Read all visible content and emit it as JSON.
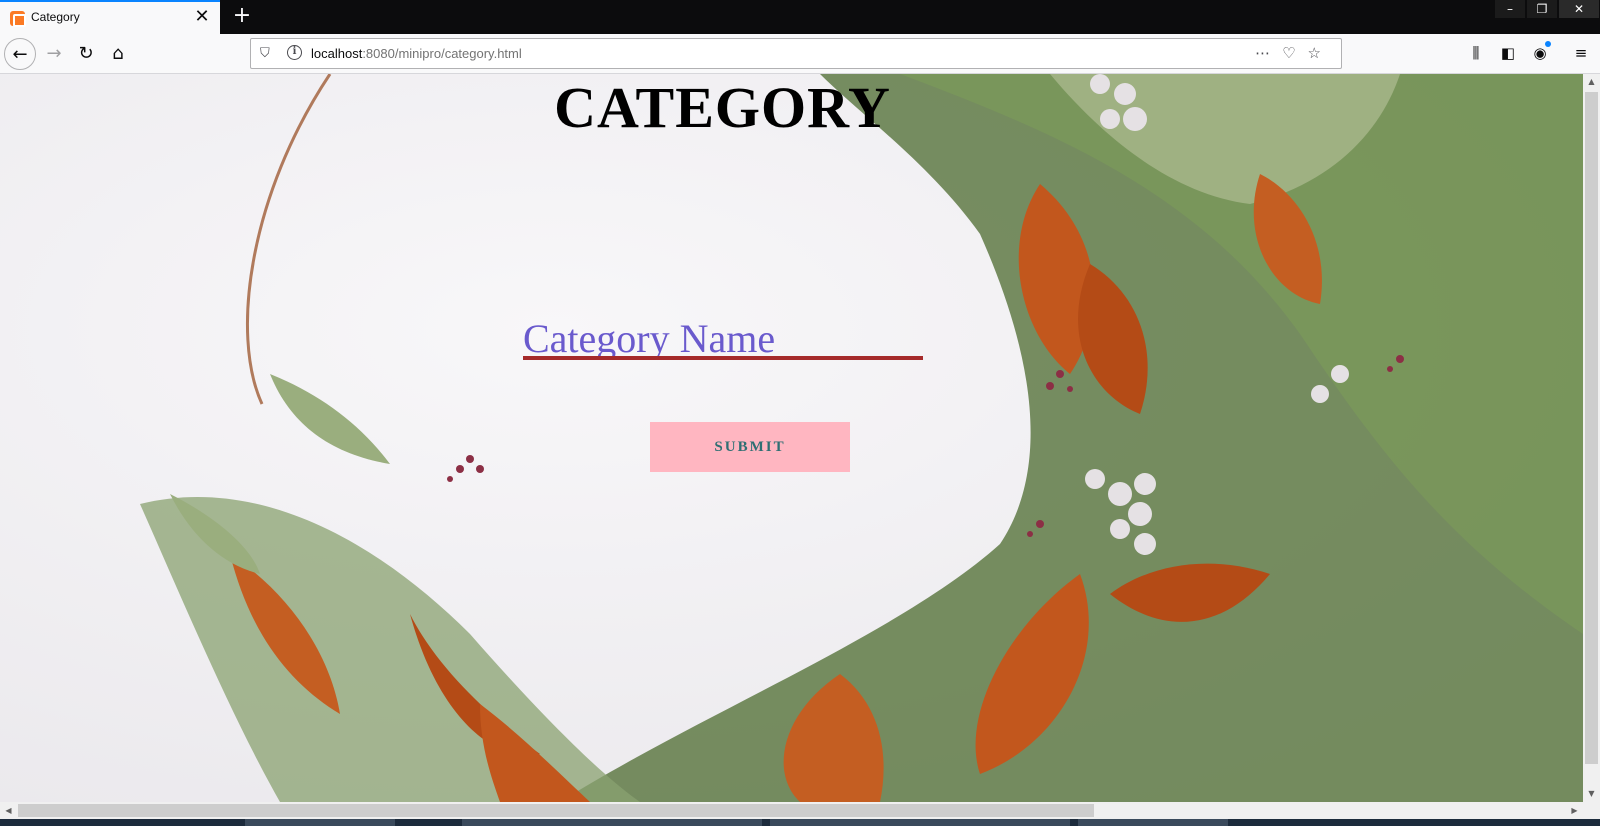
{
  "browser": {
    "tab_title": "Category",
    "url_host": "localhost",
    "url_rest": ":8080/minipro/category.html",
    "new_tab": "+",
    "tab_close": "✕"
  },
  "page": {
    "title": "CATEGORY",
    "input_placeholder": "Category Name",
    "submit_label": "SUBMIT"
  },
  "icons": {
    "back": "back-arrow-icon",
    "forward": "forward-arrow-icon",
    "reload": "reload-icon",
    "home": "home-icon",
    "shield": "tracking-shield-icon",
    "info": "site-info-icon",
    "more": "more-actions-icon",
    "pocket": "pocket-icon",
    "bookmark": "bookmark-star-icon",
    "library": "library-icon",
    "sidebar": "sidebar-icon",
    "account": "account-icon",
    "menu": "hamburger-menu-icon"
  },
  "colors": {
    "tab_accent": "#0a84ff",
    "input_text": "#6a5acd",
    "input_underline": "#a52a2a",
    "button_bg": "#ffb6c1",
    "button_text": "#2f6f73"
  }
}
